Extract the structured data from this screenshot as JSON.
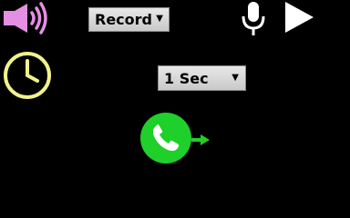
{
  "record_control": {
    "selected": "Record",
    "arrow": "▼"
  },
  "interval_control": {
    "selected": "1 Sec",
    "arrow": "▼"
  },
  "icons": {
    "speaker": "speaker-volume-icon",
    "mic": "microphone-icon",
    "play": "play-icon",
    "clock": "clock-timer-icon",
    "call": "phone-call-forward-icon"
  },
  "colors": {
    "background": "#000000",
    "speaker": "#e58fe3",
    "clock": "#f2f28a",
    "call_green": "#1fcf2a",
    "white": "#ffffff"
  }
}
